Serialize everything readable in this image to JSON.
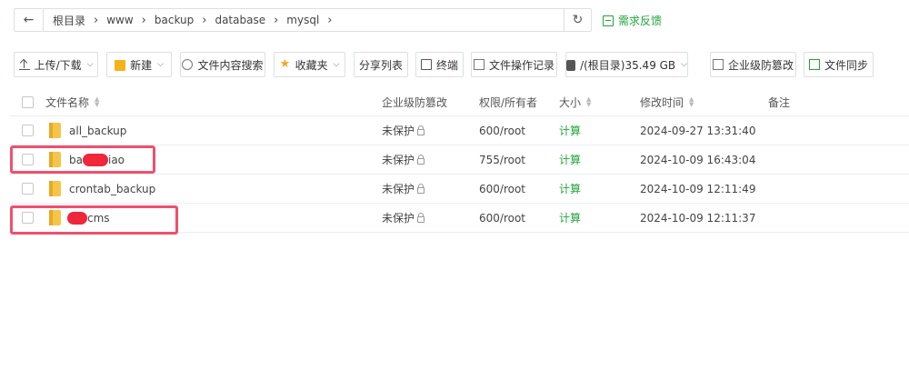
{
  "breadcrumb": {
    "items": [
      "根目录",
      "www",
      "backup",
      "database",
      "mysql"
    ]
  },
  "feedback_label": "需求反馈",
  "toolbar": {
    "upload_label": "上传/下载",
    "new_label": "新建",
    "search_label": "文件内容搜索",
    "favorites_label": "收藏夹",
    "share_label": "分享列表",
    "terminal_label": "终端",
    "oplog_label": "文件操作记录",
    "disk_label": "/(根目录)35.49 GB",
    "tamper_label": "企业级防篡改",
    "sync_label": "文件同步"
  },
  "table": {
    "headers": {
      "name": "文件名称",
      "tamper": "企业级防篡改",
      "perm": "权限/所有者",
      "size": "大小",
      "mtime": "修改时间",
      "note": "备注"
    },
    "rows": [
      {
        "name_prefix": "all_backup",
        "name_suffix": "",
        "tamper": "未保护",
        "perm": "600/root",
        "size": "计算",
        "mtime": "2024-09-27 13:31:40",
        "note": ""
      },
      {
        "name_prefix": "ba",
        "name_suffix": "iao",
        "tamper": "未保护",
        "perm": "755/root",
        "size": "计算",
        "mtime": "2024-10-09 16:43:04",
        "note": ""
      },
      {
        "name_prefix": "crontab_backup",
        "name_suffix": "",
        "tamper": "未保护",
        "perm": "600/root",
        "size": "计算",
        "mtime": "2024-10-09 12:11:49",
        "note": ""
      },
      {
        "name_prefix": "",
        "name_suffix": "cms",
        "tamper": "未保护",
        "perm": "600/root",
        "size": "计算",
        "mtime": "2024-10-09 12:11:37",
        "note": ""
      }
    ]
  },
  "colors": {
    "accent_green": "#20a53a",
    "highlight_red": "#f0506e",
    "redaction_red": "#f0263a",
    "folder_yellow": "#f5c54a"
  }
}
